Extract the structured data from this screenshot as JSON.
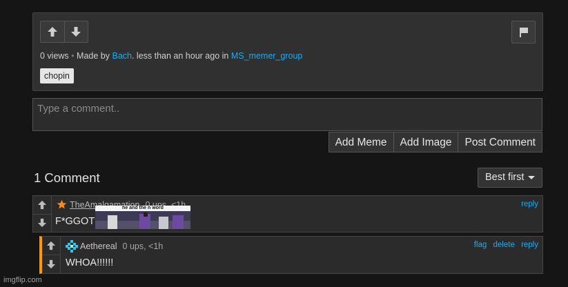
{
  "post": {
    "views": "0 views",
    "made_by_prefix": "Made by",
    "author": "Bach",
    "time_prefix": ". less than an hour ago in",
    "stream": "MS_memer_group",
    "tag": "chopin"
  },
  "comment_box": {
    "placeholder": "Type a comment.."
  },
  "buttons": {
    "add_meme": "Add Meme",
    "add_image": "Add Image",
    "post_comment": "Post Comment"
  },
  "comments_header": {
    "count": "1 Comment",
    "sort": "Best first"
  },
  "comments": [
    {
      "user": "TheAmalgamation",
      "stats": "0 ups, <1h",
      "text": "F*GGOT",
      "reply": "reply",
      "image_caption": "he and the n word"
    },
    {
      "user": "Aethereal",
      "stats": "0 ups, <1h",
      "text": "WHOA!!!!!!",
      "flag": "flag",
      "delete": "delete",
      "reply": "reply"
    }
  ],
  "watermark": "imgflip.com",
  "colors": {
    "link": "#1eaaf1",
    "accent": "#ff9900",
    "background": "#151515"
  }
}
